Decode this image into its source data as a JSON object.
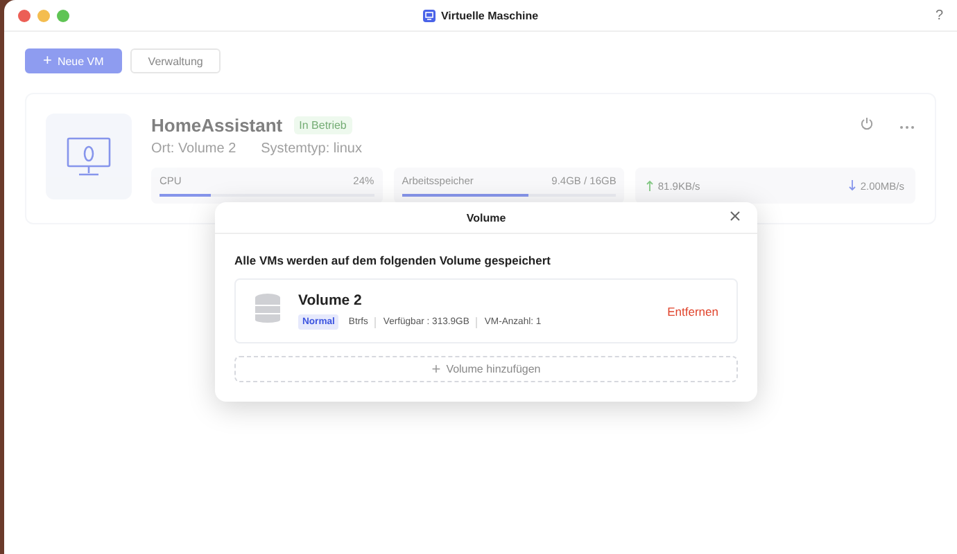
{
  "window": {
    "title": "Virtuelle Maschine",
    "help": "?"
  },
  "toolbar": {
    "buttons": [
      {
        "label": "Neue VM",
        "icon": "+",
        "kind": "primary"
      },
      {
        "label": "Verwaltung",
        "kind": "secondary"
      }
    ]
  },
  "vm": {
    "name": "HomeAssistant",
    "status": "In Betrieb",
    "location": "Ort: Volume 2",
    "system": "Systemtyp: linux",
    "meters": [
      {
        "label": "CPU",
        "reading": "24%",
        "level": 0.24
      },
      {
        "label": "Arbeitsspeicher",
        "reading": "9.4GB / 16GB",
        "level": 0.59
      }
    ],
    "upload": "81.9KB/s",
    "download": "2.00MB/s"
  },
  "dialog": {
    "title": "Volume",
    "heading": "Alle VMs werden auf dem folgenden Volume gespeichert",
    "volumes": [
      {
        "name": "Volume 2",
        "status": "Normal",
        "filesystem": "Btrfs",
        "available": "Verfügbar : 313.9GB",
        "vm_count": "VM-Anzahl: 1",
        "action": "Entfernen"
      }
    ],
    "add_button": {
      "icon": "+",
      "label": "Volume hinzufügen"
    }
  }
}
